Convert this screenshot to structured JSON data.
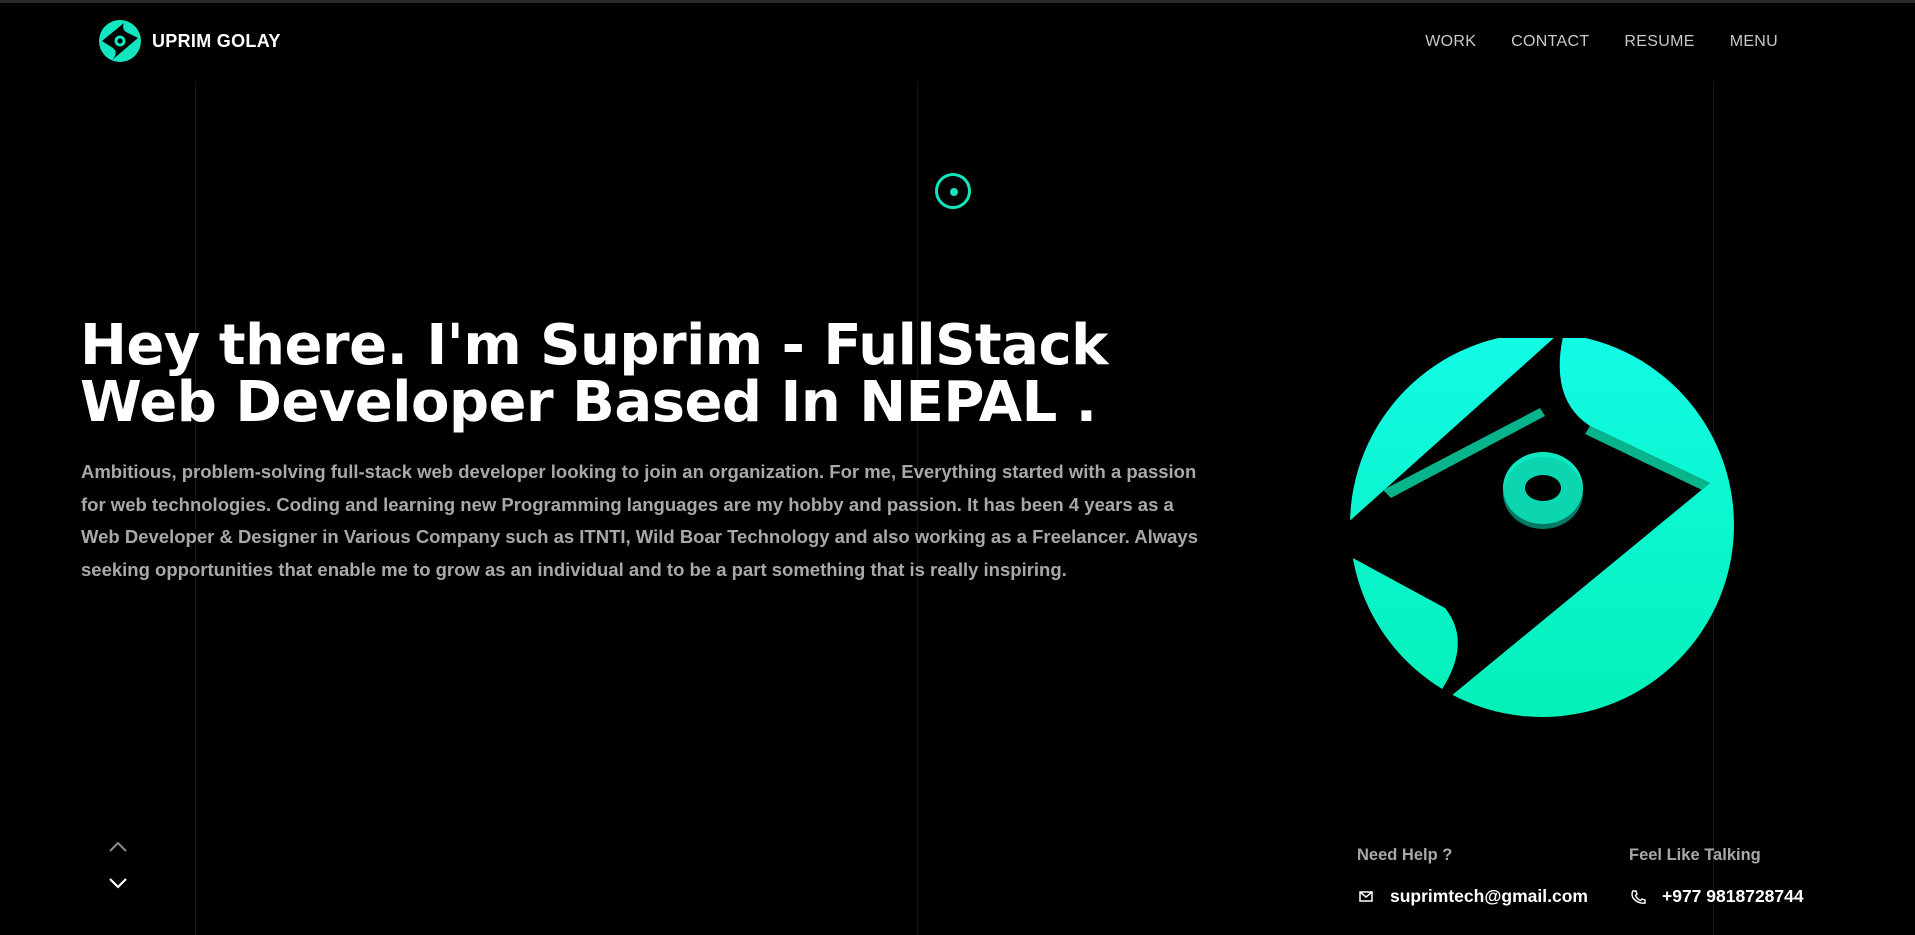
{
  "brand": {
    "name": "UPRIM GOLAY",
    "accent_color": "#12e6c0"
  },
  "nav": {
    "items": [
      "WORK",
      "CONTACT",
      "RESUME",
      "MENU"
    ]
  },
  "hero": {
    "title_line1": "Hey there. I'm Suprim - FullStack",
    "title_line2": "Web Developer Based In NEPAL .",
    "description": "Ambitious, problem-solving full-stack web developer looking to join an organization. For me, Everything started with a passion for web technologies. Coding and learning new Programming languages are my hobby and passion. It has been 4 years as a Web Developer & Designer in Various Company such as ITNTI, Wild Boar Technology and also working as a Freelancer. Always seeking opportunities that enable me to grow as an individual and to be a part something that is really inspiring."
  },
  "contact": {
    "help_label": "Need Help ?",
    "email": "suprimtech@gmail.com",
    "email_icon": "mail-icon",
    "talk_label": "Feel Like Talking",
    "phone": "+977 9818728744",
    "phone_icon": "phone-icon"
  },
  "icons": {
    "brand_logo": "brand-logo-icon",
    "cursor": "cursor-ring-icon",
    "scroll_up": "chevron-up-icon",
    "scroll_down": "chevron-down-icon",
    "hero_logo": "hero-3d-logo-icon"
  }
}
